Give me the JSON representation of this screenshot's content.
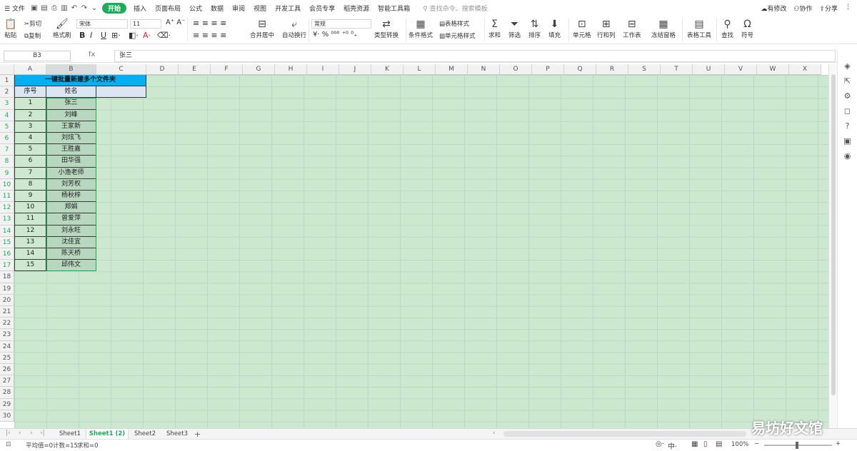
{
  "menu": {
    "file": "文件",
    "tabs": [
      "开始",
      "插入",
      "页面布局",
      "公式",
      "数据",
      "审阅",
      "视图",
      "开发工具",
      "会员专享",
      "稻壳资源",
      "智能工具箱"
    ],
    "search": "查找命令、搜索模板",
    "right": [
      "有修改",
      "协作",
      "分享"
    ]
  },
  "ribbon": {
    "paste": "粘贴",
    "cut": "剪切",
    "copy": "复制",
    "format_painter": "格式刷",
    "font": "宋体",
    "size": "11",
    "bold": "B",
    "italic": "I",
    "underline": "U",
    "merge": "合并居中",
    "wrap": "自动换行",
    "num_format": "常规",
    "type_convert": "类型转换",
    "cond_format": "条件格式",
    "table_style": "表格样式",
    "cell_style": "单元格样式",
    "sum": "求和",
    "filter": "筛选",
    "sort": "排序",
    "fill": "填充",
    "cells": "单元格",
    "rowcol": "行和列",
    "worksheet": "工作表",
    "freeze": "冻结窗格",
    "table_tools": "表格工具",
    "find": "查找",
    "symbol": "符号"
  },
  "formula": {
    "cell_ref": "B3",
    "fx": "fx",
    "content": "张三"
  },
  "columns": [
    "A",
    "B",
    "C",
    "D",
    "E",
    "F",
    "G",
    "H",
    "I",
    "J",
    "K",
    "L",
    "M",
    "N",
    "O",
    "P",
    "Q",
    "R",
    "S",
    "T",
    "U",
    "V",
    "W",
    "X"
  ],
  "rows": [
    "1",
    "2",
    "3",
    "4",
    "5",
    "6",
    "7",
    "8",
    "9",
    "10",
    "11",
    "12",
    "13",
    "14",
    "15",
    "16",
    "17",
    "18",
    "19",
    "20",
    "21",
    "22",
    "23",
    "24",
    "25",
    "26",
    "27",
    "28",
    "29",
    "30"
  ],
  "table": {
    "title": "一键批量新建多个文件夹",
    "headers": [
      "序号",
      "姓名"
    ],
    "data": [
      [
        "1",
        "张三"
      ],
      [
        "2",
        "刘峰"
      ],
      [
        "3",
        "王家新"
      ],
      [
        "4",
        "刘炫飞"
      ],
      [
        "5",
        "王胜嘉"
      ],
      [
        "6",
        "田华强"
      ],
      [
        "7",
        "小渔老师"
      ],
      [
        "8",
        "刘芳权"
      ],
      [
        "9",
        "杨秋梓"
      ],
      [
        "10",
        "郑娟"
      ],
      [
        "11",
        "曾爱萍"
      ],
      [
        "12",
        "刘永旺"
      ],
      [
        "13",
        "沈佳宜"
      ],
      [
        "14",
        "陈天桥"
      ],
      [
        "15",
        "邱伟文"
      ]
    ]
  },
  "sheets": [
    "Sheet1",
    "Sheet1 (2)",
    "Sheet2",
    "Sheet3"
  ],
  "active_sheet": "Sheet1 (2)",
  "status": {
    "avg": "平均值=0",
    "count": "计数=15",
    "sum": "求和=0",
    "zoom": "100%"
  },
  "watermark": "易坊好文馆",
  "colors": {
    "accent": "#1aad5a",
    "title_bg": "#00b0f0",
    "grid_bg": "#cce8cf"
  }
}
